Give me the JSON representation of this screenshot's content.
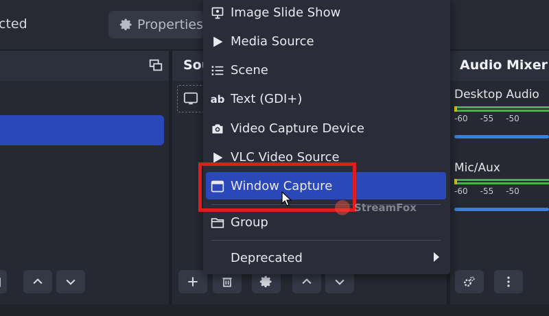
{
  "topbar": {
    "status_text": "cted",
    "properties_label": "Properties"
  },
  "sources": {
    "title": "Sou"
  },
  "mixer": {
    "title": "Audio Mixer",
    "channels": [
      {
        "name": "Desktop Audio",
        "scale": [
          "-60",
          "-55",
          "-50"
        ]
      },
      {
        "name": "Mic/Aux",
        "scale": [
          "-60",
          "-55",
          "-50"
        ]
      }
    ]
  },
  "menu": {
    "items": [
      {
        "label": "Image Slide Show",
        "icon": "slideshow-icon"
      },
      {
        "label": "Media Source",
        "icon": "play-icon"
      },
      {
        "label": "Scene",
        "icon": "list-icon"
      },
      {
        "label": "Text (GDI+)",
        "icon": "text-ab-icon"
      },
      {
        "label": "Video Capture Device",
        "icon": "camera-icon"
      },
      {
        "label": "VLC Video Source",
        "icon": "play-icon"
      },
      {
        "label": "Window Capture",
        "icon": "window-icon",
        "selected": true
      },
      {
        "label": "Group",
        "icon": "folder-icon"
      },
      {
        "label": "Deprecated",
        "icon": "",
        "submenu": true
      }
    ]
  },
  "watermark": {
    "text": "StreamFox"
  },
  "colors": {
    "background": "#1d1f26",
    "panel": "#262932",
    "selection": "#2b48b8",
    "highlight_box": "#e01d1d",
    "meter_green": "#4caf50",
    "fader_blue": "#3c7fd6"
  }
}
